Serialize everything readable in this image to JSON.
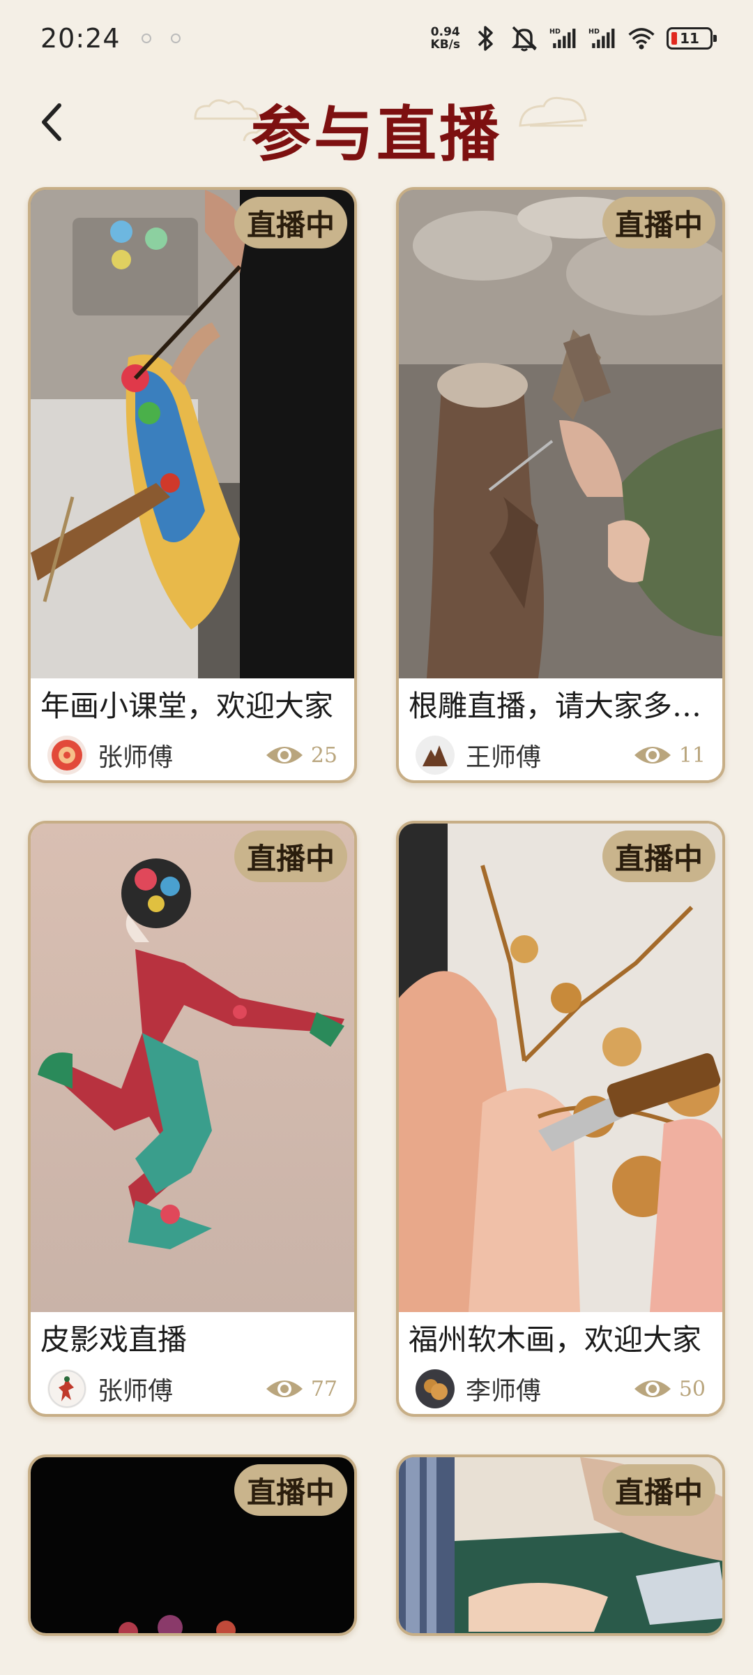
{
  "status_bar": {
    "time": "20:24",
    "net_speed_value": "0.94",
    "net_speed_unit": "KB/s",
    "battery": "11",
    "icons": [
      "bluetooth-icon",
      "mute-bell-icon",
      "signal-hd-icon",
      "signal-hd-icon",
      "wifi-icon",
      "battery-icon"
    ]
  },
  "header": {
    "title": "参与直播",
    "back_icon": "chevron-left-icon"
  },
  "cards": [
    {
      "badge": "直播中",
      "title": "年画小课堂，欢迎大家",
      "host": "张师傅",
      "views": "25",
      "image": "new-year-painting"
    },
    {
      "badge": "直播中",
      "title": "根雕直播，请大家多…",
      "host": "王师傅",
      "views": "11",
      "image": "root-carving"
    },
    {
      "badge": "直播中",
      "title": "皮影戏直播",
      "host": "张师傅",
      "views": "77",
      "image": "shadow-puppet"
    },
    {
      "badge": "直播中",
      "title": "福州软木画，欢迎大家",
      "host": "李师傅",
      "views": "50",
      "image": "cork-painting"
    },
    {
      "badge": "直播中",
      "image": "stage-performance"
    },
    {
      "badge": "直播中",
      "image": "paper-cutting"
    }
  ],
  "colors": {
    "background": "#f4efe6",
    "title": "#7d1010",
    "badge": "#c9b48c",
    "card_border": "#c7ae86",
    "views": "#b9a57d"
  }
}
